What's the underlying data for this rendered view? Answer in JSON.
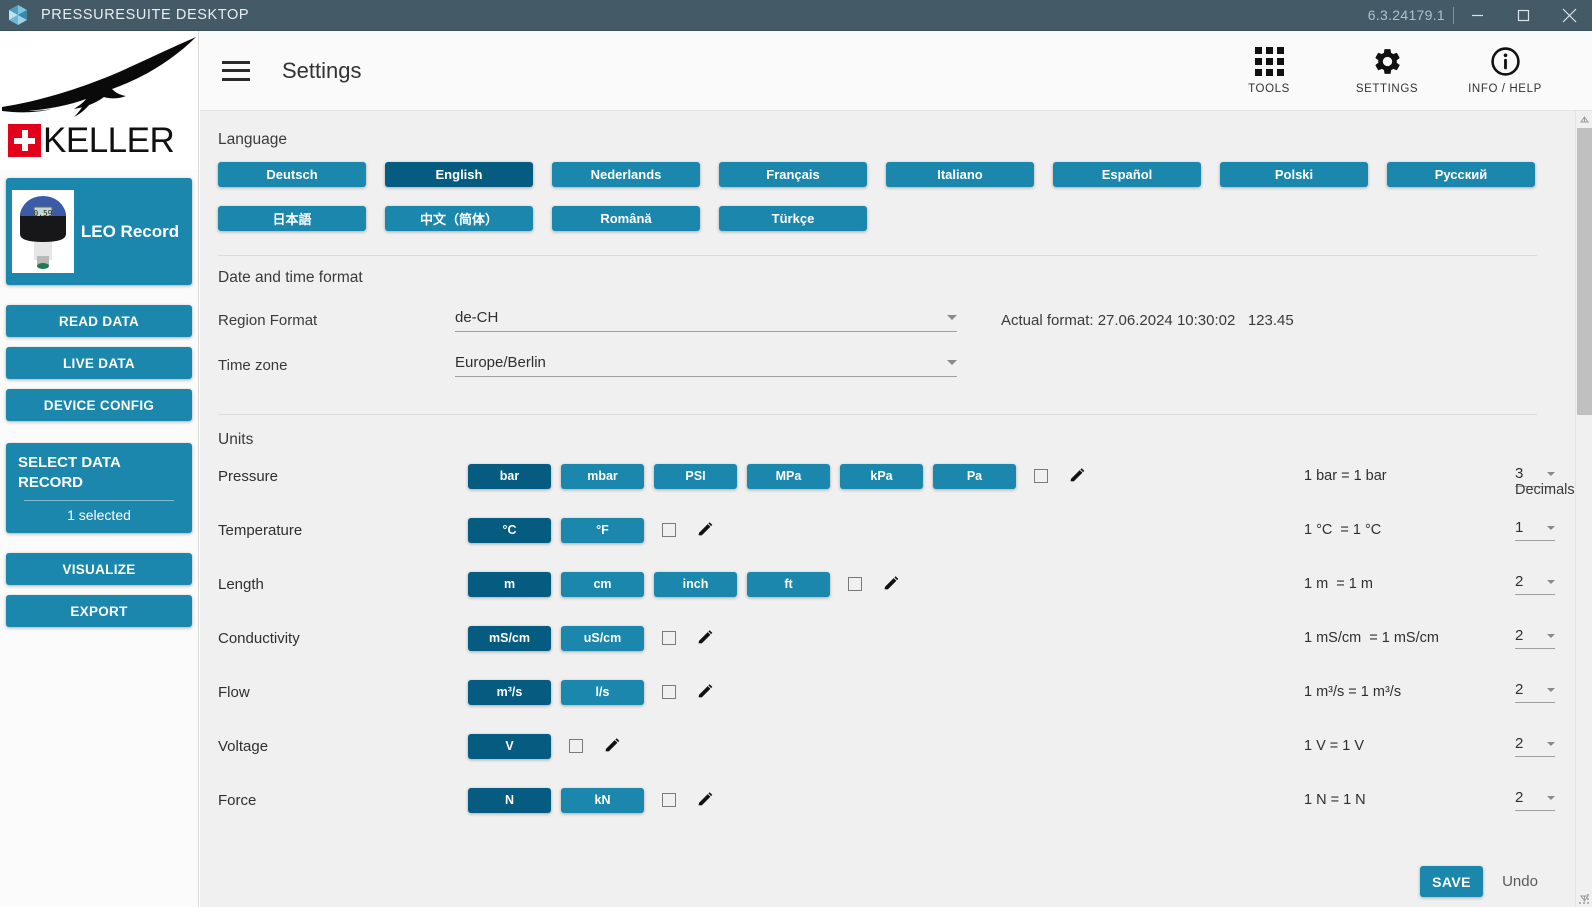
{
  "titlebar": {
    "app_name": "PRESSURESUITE DESKTOP",
    "version": "6.3.24179.1",
    "logo_icon": "cube-logo-icon",
    "minimize_icon": "minimize-icon",
    "maximize_icon": "maximize-icon",
    "close_icon": "close-icon"
  },
  "sidebar": {
    "brand": {
      "logo_icon": "keller-bird-logo",
      "cross_icon": "swiss-cross-icon",
      "wordmark": "KELLER"
    },
    "device": {
      "name": "LEO Record",
      "thumb_icon": "pressure-gauge-photo"
    },
    "buttons": [
      {
        "label": "READ DATA"
      },
      {
        "label": "LIVE DATA"
      },
      {
        "label": "DEVICE CONFIG"
      },
      {
        "label": "VISUALIZE"
      },
      {
        "label": "EXPORT"
      }
    ],
    "select_record": {
      "title": "SELECT DATA RECORD",
      "subtitle": "1 selected"
    }
  },
  "header": {
    "menu_icon": "hamburger-menu-icon",
    "title": "Settings",
    "actions": [
      {
        "label": "TOOLS",
        "icon": "grid-apps-icon"
      },
      {
        "label": "SETTINGS",
        "icon": "gear-icon"
      },
      {
        "label": "INFO / HELP",
        "icon": "info-circle-icon"
      }
    ]
  },
  "language": {
    "section_title": "Language",
    "selected": "English",
    "options": [
      "Deutsch",
      "English",
      "Nederlands",
      "Français",
      "Italiano",
      "Español",
      "Polski",
      "Русский",
      "日本語",
      "中文（简体）",
      "Română",
      "Türkçe"
    ]
  },
  "datetime": {
    "section_title": "Date and time format",
    "region_label": "Region Format",
    "region_value": "de-CH",
    "timezone_label": "Time zone",
    "timezone_value": "Europe/Berlin",
    "actual_format": "Actual format: 27.06.2024 10:30:02   123.45"
  },
  "units": {
    "section_title": "Units",
    "decimals_header": "Decimals",
    "checkbox_icon": "checkbox-unchecked-icon",
    "edit_icon": "pencil-edit-icon",
    "rows": [
      {
        "label": "Pressure",
        "options": [
          "bar",
          "mbar",
          "PSI",
          "MPa",
          "kPa",
          "Pa"
        ],
        "selected": "bar",
        "checked": false,
        "conversion": "1 bar = 1 bar",
        "decimals": "3"
      },
      {
        "label": "Temperature",
        "options": [
          "°C",
          "°F"
        ],
        "selected": "°C",
        "checked": false,
        "conversion": "1 °C  = 1 °C",
        "decimals": "1"
      },
      {
        "label": "Length",
        "options": [
          "m",
          "cm",
          "inch",
          "ft"
        ],
        "selected": "m",
        "checked": false,
        "conversion": "1 m  = 1 m",
        "decimals": "2"
      },
      {
        "label": "Conductivity",
        "options": [
          "mS/cm",
          "uS/cm"
        ],
        "selected": "mS/cm",
        "checked": false,
        "conversion": "1 mS/cm  = 1 mS/cm",
        "decimals": "2"
      },
      {
        "label": "Flow",
        "options": [
          "m³/s",
          "l/s"
        ],
        "selected": "m³/s",
        "checked": false,
        "conversion": "1 m³/s = 1 m³/s",
        "decimals": "2"
      },
      {
        "label": "Voltage",
        "options": [
          "V"
        ],
        "selected": "V",
        "checked": false,
        "conversion": "1 V = 1 V",
        "decimals": "2"
      },
      {
        "label": "Force",
        "options": [
          "N",
          "kN"
        ],
        "selected": "N",
        "checked": false,
        "conversion": "1 N = 1 N",
        "decimals": "2"
      }
    ]
  },
  "footer": {
    "save_label": "SAVE",
    "undo_label": "Undo"
  },
  "scrollbar": {
    "up_icon": "scroll-up-arrow-icon",
    "down_icon": "scroll-down-arrow-icon"
  },
  "colors": {
    "titlebar": "#445a66",
    "accent": "#1b87ac",
    "accent_selected": "#055c80",
    "content_bg": "#f0f0f0",
    "swiss_red": "#e2001a"
  }
}
